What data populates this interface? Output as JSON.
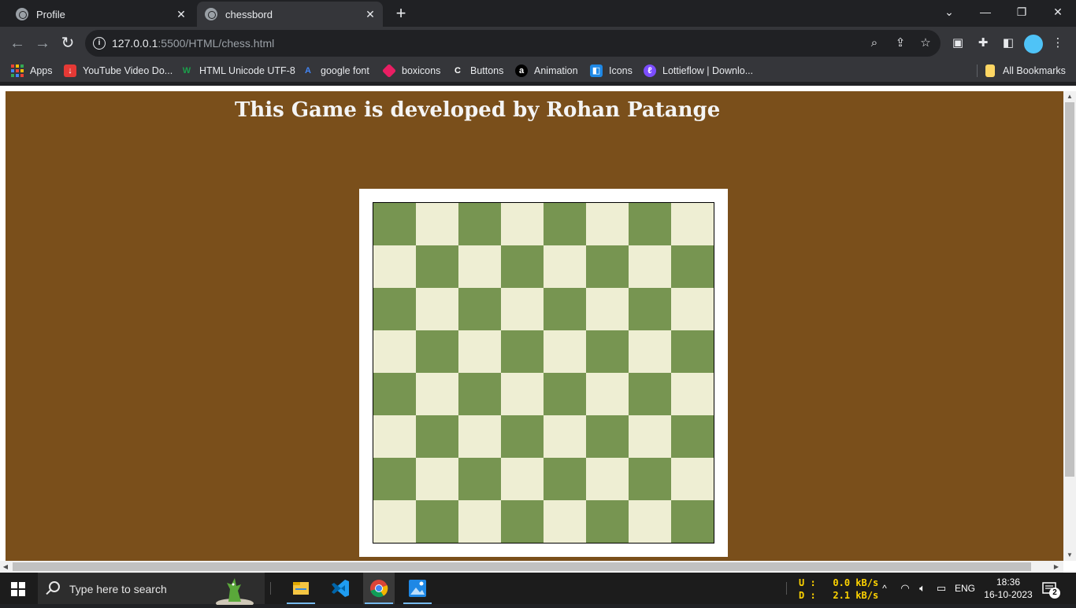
{
  "browser": {
    "tabs": [
      {
        "label": "Profile",
        "active": false
      },
      {
        "label": "chessbord",
        "active": true
      }
    ],
    "new_tab_icon": "plus-icon",
    "window_controls": [
      "chevron-down-icon",
      "minimize-icon",
      "restore-icon",
      "close-icon"
    ],
    "url_host": "127.0.0.1",
    "url_rest": ":5500/HTML/chess.html",
    "bookmarks": [
      {
        "label": "Apps",
        "icon": "apps-grid-icon"
      },
      {
        "label": "YouTube Video Do...",
        "icon": "download-icon",
        "color": "#e53935"
      },
      {
        "label": "HTML Unicode UTF-8",
        "icon": "w3-icon",
        "color": "#1b9e4b"
      },
      {
        "label": "google font",
        "icon": "google-fonts-icon",
        "color": "#4285f4"
      },
      {
        "label": "boxicons",
        "icon": "boxicons-icon",
        "color": "#e91e63"
      },
      {
        "label": "Buttons",
        "icon": "c-icon",
        "color": "#ffffff"
      },
      {
        "label": "Animation",
        "icon": "a-icon",
        "color": "#000000"
      },
      {
        "label": "Icons",
        "icon": "icons8-icon",
        "color": "#1e88e5"
      },
      {
        "label": "Lottieflow | Downlo...",
        "icon": "lottie-icon",
        "color": "#7c4dff"
      }
    ],
    "all_bookmarks": "All Bookmarks"
  },
  "page": {
    "title": "This Game is developed by Rohan Patange",
    "background_color": "#7a4f1b",
    "board": {
      "rows": 8,
      "cols": 8,
      "dark_color": "#779551",
      "light_color": "#eeeed3",
      "top_left": "dark"
    }
  },
  "taskbar": {
    "search_placeholder": "Type here to search",
    "apps": [
      "file-explorer-icon",
      "vscode-icon",
      "chrome-icon",
      "photos-icon"
    ],
    "net_upload_label": "U :",
    "net_upload_value": "0.0 kB/s",
    "net_download_label": "D :",
    "net_download_value": "2.1 kB/s",
    "language": "ENG",
    "time": "18:36",
    "date": "16-10-2023",
    "notification_count": "2"
  }
}
